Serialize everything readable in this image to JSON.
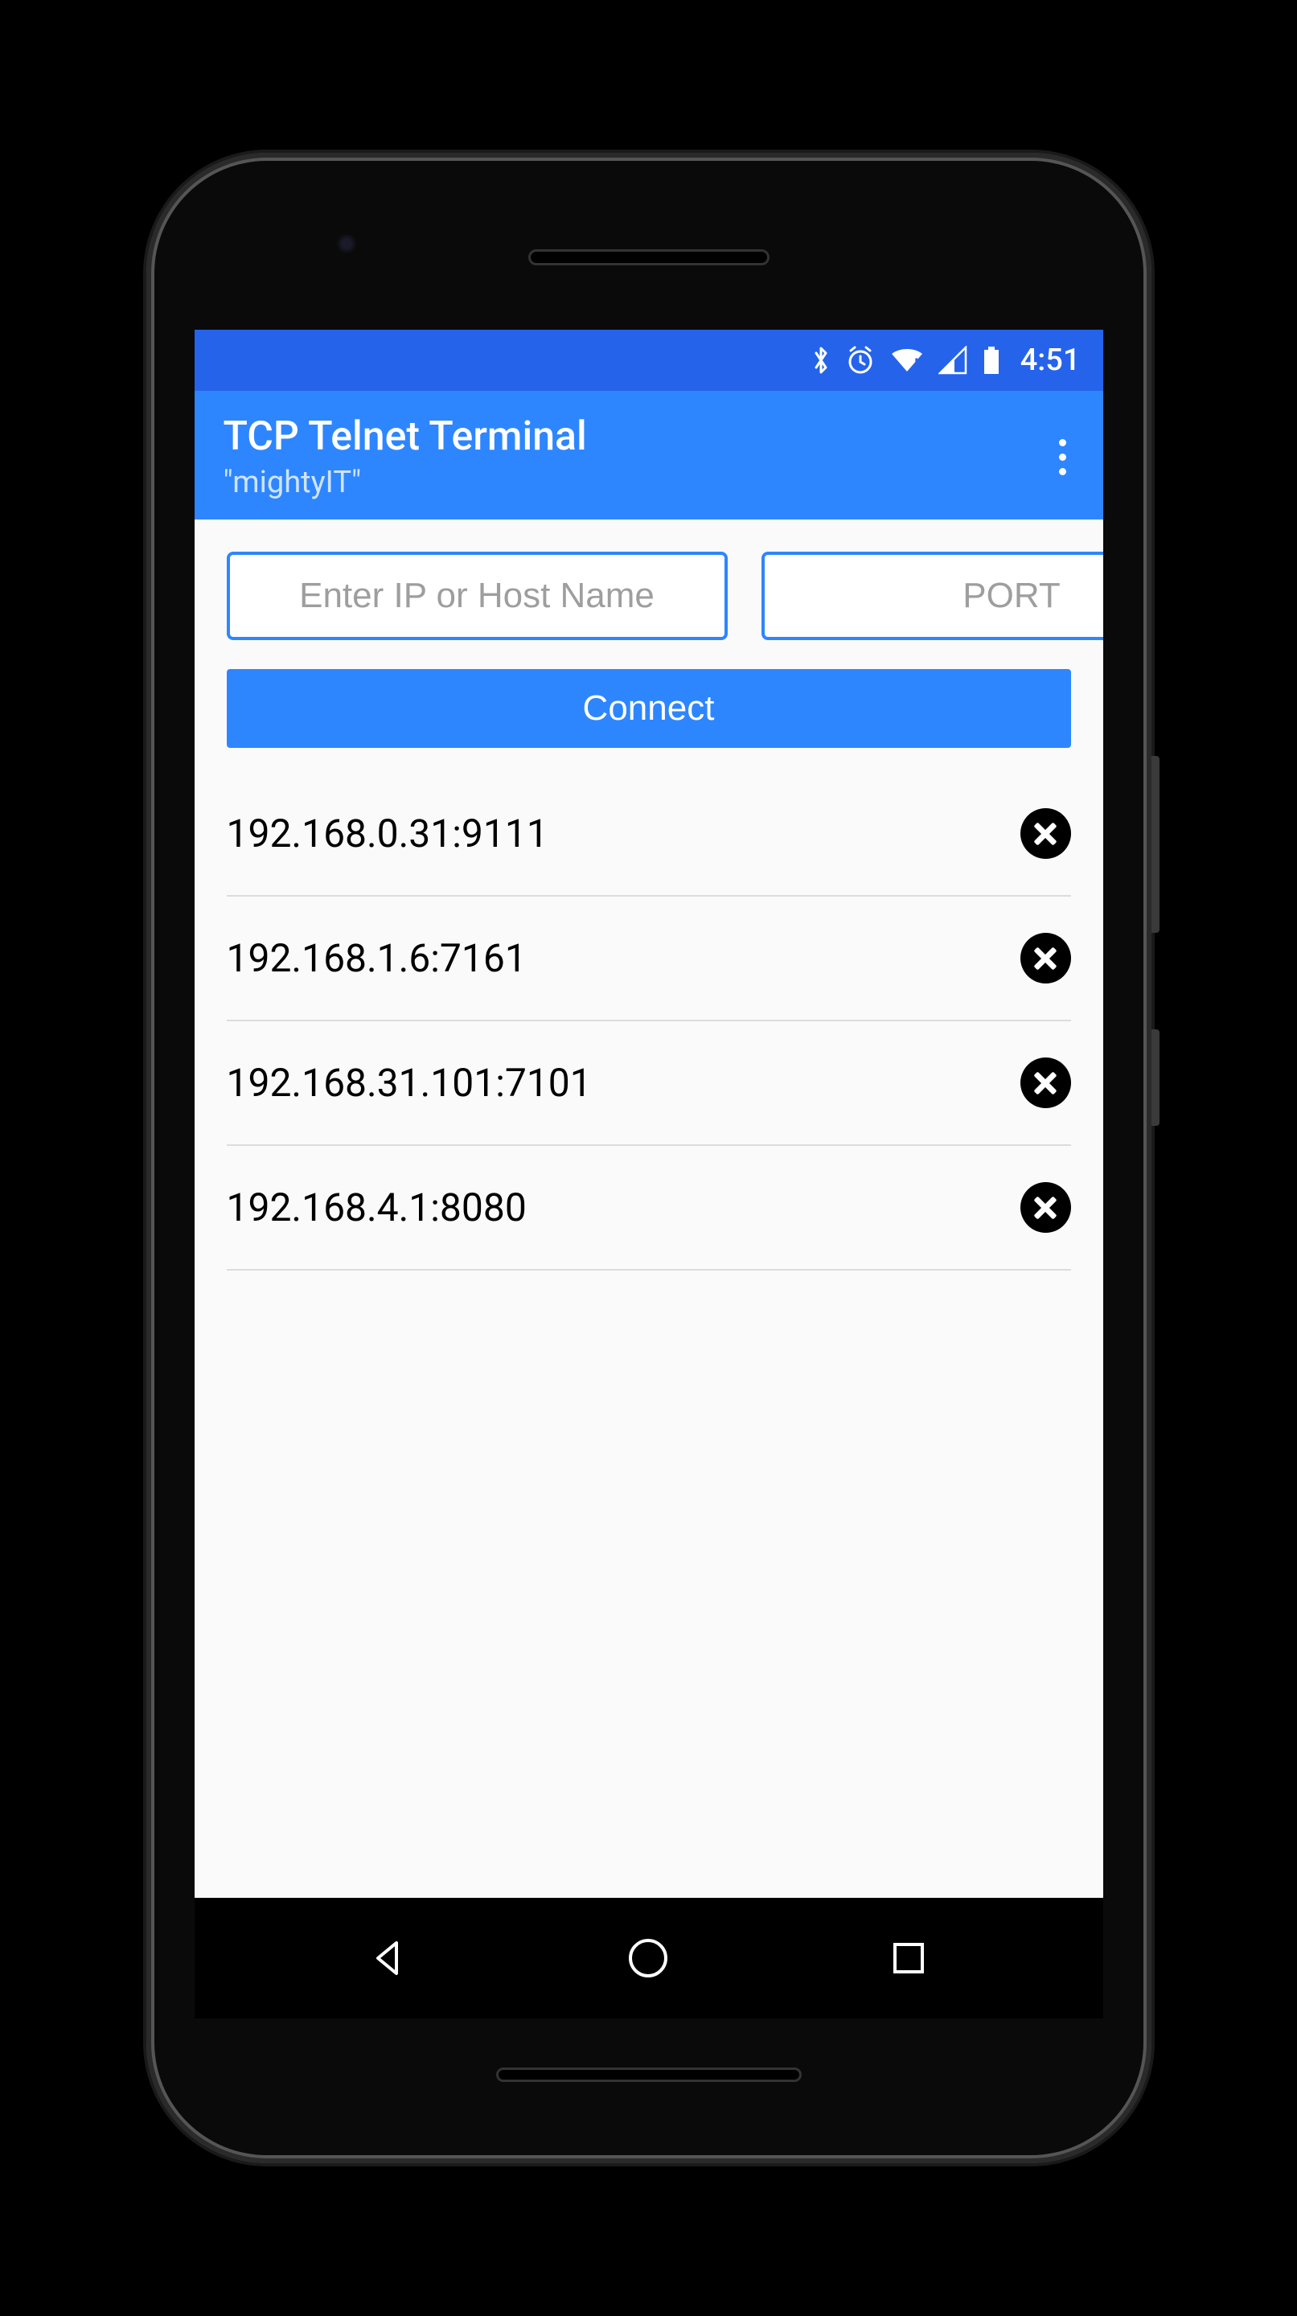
{
  "statusBar": {
    "time": "4:51"
  },
  "appBar": {
    "title": "TCP Telnet Terminal",
    "subtitle": "\"mightyIT\""
  },
  "form": {
    "hostPlaceholder": "Enter IP or Host Name",
    "portPlaceholder": "PORT",
    "connectLabel": "Connect"
  },
  "history": [
    {
      "address": "192.168.0.31:9111"
    },
    {
      "address": "192.168.1.6:7161"
    },
    {
      "address": "192.168.31.101:7101"
    },
    {
      "address": "192.168.4.1:8080"
    }
  ]
}
